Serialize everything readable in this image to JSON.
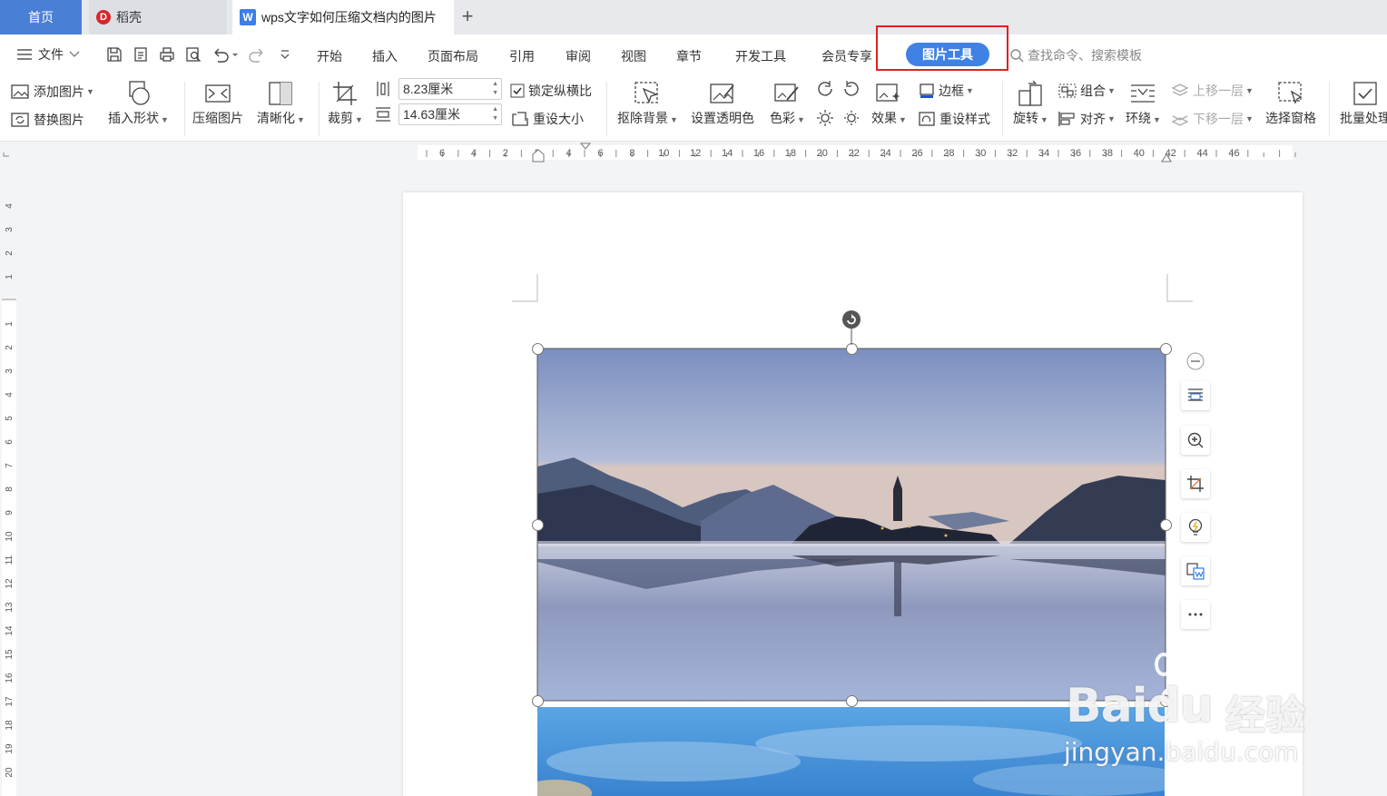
{
  "tabs": {
    "home": "首页",
    "daoke": "稻壳",
    "daoke_logo": "D",
    "doc_logo": "W",
    "doc_title": "wps文字如何压缩文档内的图片",
    "add": "+"
  },
  "menu": {
    "file_label": "文件",
    "items": [
      "开始",
      "插入",
      "页面布局",
      "引用",
      "审阅",
      "视图",
      "章节",
      "开发工具",
      "会员专享"
    ],
    "active_tab": "图片工具",
    "search_placeholder": "查找命令、搜索模板"
  },
  "ribbon": {
    "add_picture": "添加图片",
    "replace_picture": "替换图片",
    "insert_shape": "插入形状",
    "compress_picture": "压缩图片",
    "sharpen": "清晰化",
    "crop": "裁剪",
    "height_value": "8.23厘米",
    "width_value": "14.63厘米",
    "lock_ratio": "锁定纵横比",
    "reset_size": "重设大小",
    "remove_bg": "抠除背景",
    "set_transparent": "设置透明色",
    "color": "色彩",
    "effects": "效果",
    "border": "边框",
    "reset_style": "重设样式",
    "rotate": "旋转",
    "group": "组合",
    "align": "对齐",
    "wrap": "环绕",
    "bring_forward": "上移一层",
    "send_backward": "下移一层",
    "select_pane": "选择窗格",
    "batch_process": "批量处理"
  },
  "ruler": {
    "h_labels": [
      "6",
      "4",
      "2",
      "2",
      "4",
      "6",
      "8",
      "10",
      "12",
      "14",
      "16",
      "18",
      "20",
      "22",
      "24",
      "26",
      "28",
      "30",
      "32",
      "34",
      "36",
      "38",
      "40",
      "42",
      "44",
      "46"
    ],
    "v_labels_top": [
      "4",
      "3",
      "2",
      "1"
    ],
    "v_labels": [
      "1",
      "2",
      "3",
      "4",
      "5",
      "6",
      "7",
      "8",
      "9",
      "10",
      "11",
      "12",
      "13",
      "14",
      "15",
      "16",
      "17",
      "18",
      "19",
      "20"
    ]
  },
  "watermark": {
    "brand": "Baidu",
    "brand_cn": "经验",
    "url": "jingyan.baidu.com"
  },
  "colors": {
    "accent": "#3f82e4",
    "highlight": "#e02020",
    "home_tab": "#4a7fd6"
  }
}
